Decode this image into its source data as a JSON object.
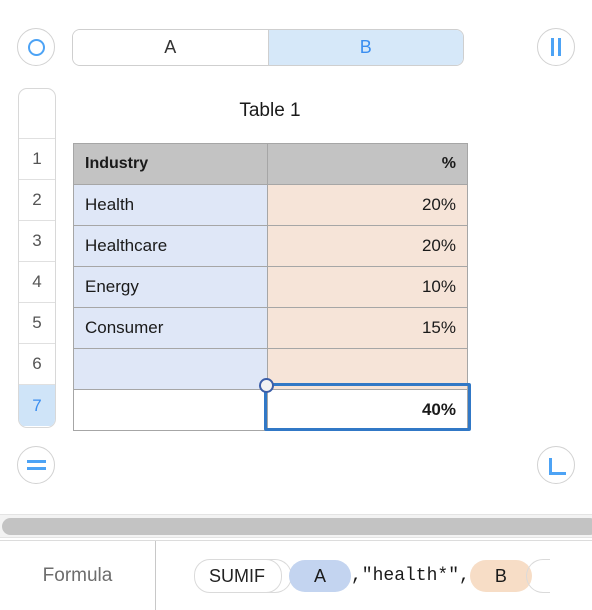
{
  "toolbar": {
    "prev_icon": "circle-ring-icon",
    "next_icon": "pause-bars-icon",
    "tabs": [
      {
        "label": "A",
        "selected": false
      },
      {
        "label": "B",
        "selected": true
      }
    ]
  },
  "sheet": {
    "table_title": "Table 1",
    "row_headers": [
      "1",
      "2",
      "3",
      "4",
      "5",
      "6",
      "7"
    ],
    "selected_row_header": "7",
    "columns": [
      "Industry",
      "%"
    ],
    "rows": [
      {
        "industry": "Health",
        "percent": "20%"
      },
      {
        "industry": "Healthcare",
        "percent": "20%"
      },
      {
        "industry": "Energy",
        "percent": "10%"
      },
      {
        "industry": "Consumer",
        "percent": "15%"
      },
      {
        "industry": "",
        "percent": ""
      }
    ],
    "result_row": {
      "industry": "",
      "percent": "40%"
    }
  },
  "footer": {
    "equals_icon": "equals-icon",
    "return_icon": "return-corner-icon"
  },
  "formula": {
    "label": "Formula",
    "function_name": "SUMIF",
    "token_a": "A",
    "middle_text": ",\"health*\",",
    "token_b": "B"
  },
  "colors": {
    "accent_blue": "#3b8ef0",
    "tab_selected_bg": "#d6e8f9",
    "col_a_select_bg": "#dfe7f7",
    "col_a_select_border": "#2f6fd0",
    "col_b_select_bg": "#f6e4d8",
    "col_b_select_border": "#c0571a",
    "header_bg": "#c3c3c3",
    "active_cell_border": "#3178c6"
  }
}
